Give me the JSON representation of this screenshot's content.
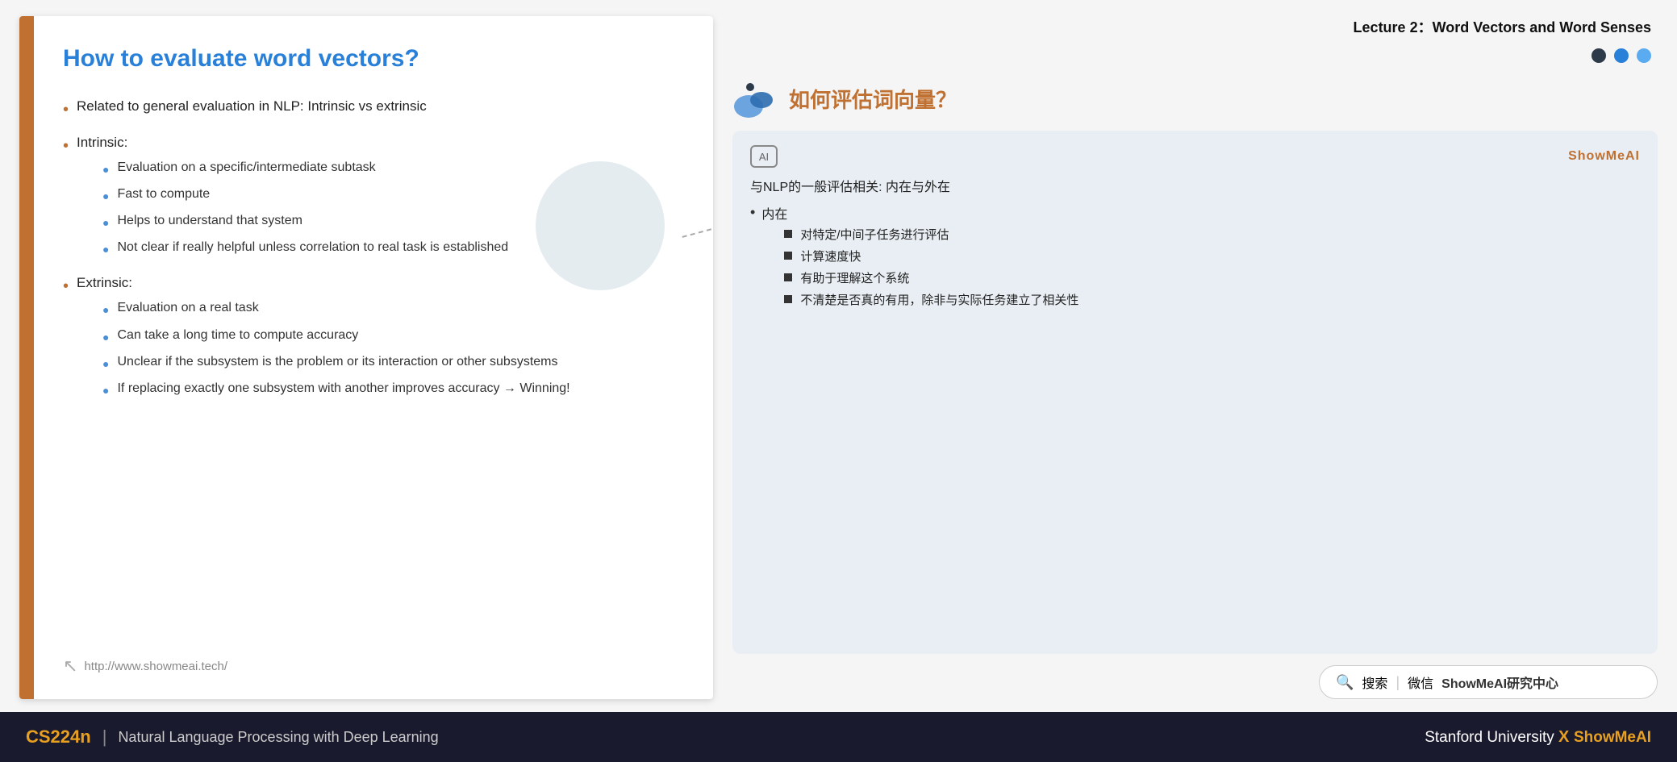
{
  "lecture": {
    "title": "Lecture 2：Word Vectors and Word Senses"
  },
  "dots": [
    {
      "color": "dark",
      "label": "dot-1"
    },
    {
      "color": "blue",
      "label": "dot-2"
    },
    {
      "color": "light-blue",
      "label": "dot-3"
    }
  ],
  "slide": {
    "title": "How to evaluate word vectors?",
    "left_bar_color": "#c07030",
    "footer_url": "http://www.showmeai.tech/",
    "bullets": [
      {
        "text": "Related to general evaluation in NLP: Intrinsic vs extrinsic",
        "sub": []
      },
      {
        "text": "Intrinsic:",
        "sub": [
          "Evaluation on a specific/intermediate subtask",
          "Fast to compute",
          "Helps to understand that system",
          "Not clear if really helpful unless correlation to real task is established"
        ]
      },
      {
        "text": "Extrinsic:",
        "sub": [
          "Evaluation on a real task",
          "Can take a long time to compute accuracy",
          "Unclear if the subsystem is the problem or its interaction or other subsystems",
          "If replacing exactly one subsystem with another improves accuracy → Winning!"
        ]
      }
    ]
  },
  "chinese_section": {
    "title": "如何评估词向量？",
    "card": {
      "ai_icon": "AI",
      "brand": "ShowMeAI",
      "intro": "与NLP的一般评估相关: 内在与外在",
      "bullets": [
        {
          "text": "内在",
          "sub": [
            "对特定/中间子任务进行评估",
            "计算速度快",
            "有助于理解这个系统",
            "不清楚是否真的有用，除非与实际任务建立了相关性"
          ]
        }
      ]
    }
  },
  "search": {
    "icon": "🔍",
    "divider": "|",
    "prefix": "搜索",
    "divider2": "微信",
    "label": "ShowMeAI研究中心"
  },
  "footer": {
    "cs224n": "CS224n",
    "divider": "|",
    "subtitle": "Natural Language Processing with Deep Learning",
    "right_text": "Stanford University",
    "x": "X",
    "brand": "ShowMeAI"
  }
}
